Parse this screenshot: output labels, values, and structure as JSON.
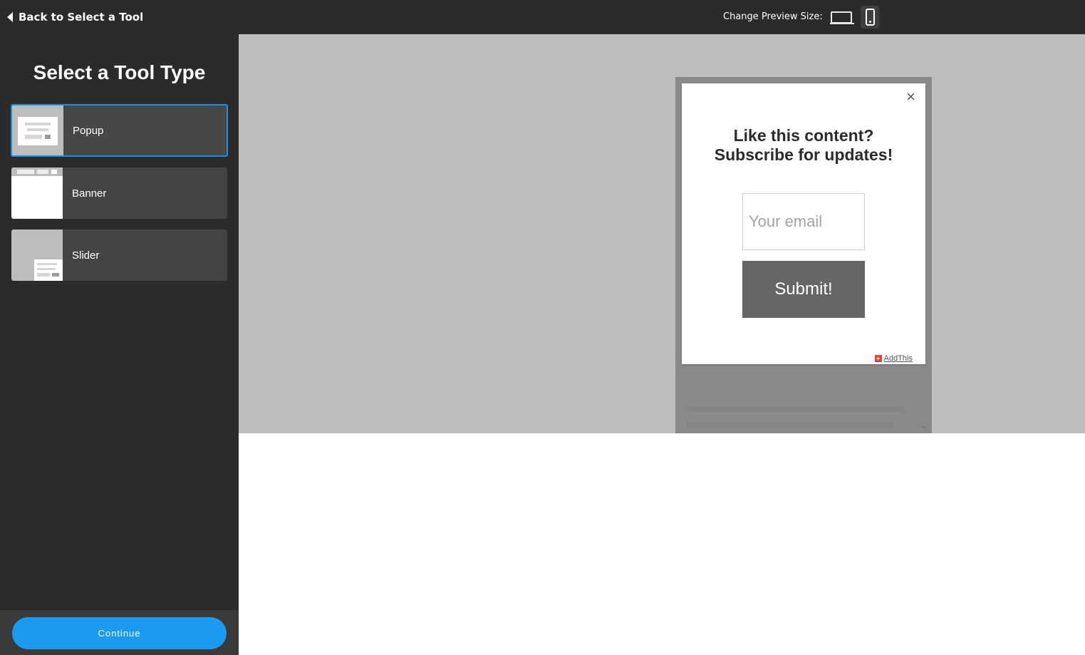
{
  "topbar": {
    "back_label": "Back to Select a Tool",
    "preview_label": "Change Preview Size:",
    "devices": [
      {
        "icon": "laptop-icon",
        "selected": false
      },
      {
        "icon": "phone-icon",
        "selected": true
      }
    ]
  },
  "sidebar": {
    "title": "Select a Tool Type",
    "tools": [
      {
        "label": "Popup",
        "selected": true
      },
      {
        "label": "Banner",
        "selected": false
      },
      {
        "label": "Slider",
        "selected": false
      }
    ],
    "continue_label": "Continue"
  },
  "preview": {
    "popup": {
      "close_symbol": "×",
      "heading_line1": "Like this content?",
      "heading_line2": "Subscribe for updates!",
      "email_placeholder": "Your email",
      "submit_label": "Submit!",
      "branding_label": "AddThis",
      "branding_icon": "addthis-plus-icon"
    }
  },
  "colors": {
    "topbar_bg": "#2b2b2b",
    "sidebar_bg": "#2b2b2b",
    "accent": "#1a9bf0",
    "selected_border": "#1a8fe3",
    "preview_bg": "#bebebe",
    "submit_bg": "#666666",
    "branding_red": "#e0453b"
  }
}
